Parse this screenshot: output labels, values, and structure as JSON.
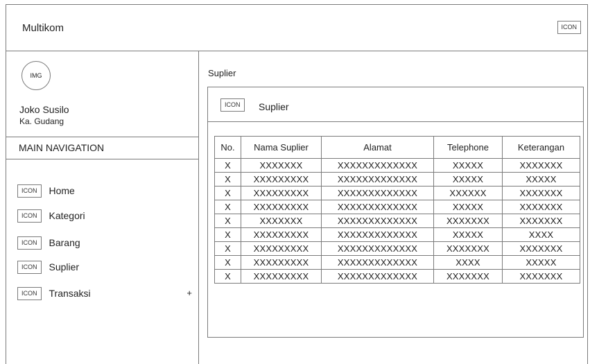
{
  "header": {
    "app_title": "Multikom",
    "icon_label": "ICON"
  },
  "sidebar": {
    "avatar_label": "IMG",
    "user_name": "Joko Susilo",
    "user_role": "Ka. Gudang",
    "nav_header": "MAIN NAVIGATION",
    "items": [
      {
        "icon": "ICON",
        "label": "Home"
      },
      {
        "icon": "ICON",
        "label": "Kategori"
      },
      {
        "icon": "ICON",
        "label": "Barang"
      },
      {
        "icon": "ICON",
        "label": "Suplier"
      },
      {
        "icon": "ICON",
        "label": "Transaksi",
        "expand": "+"
      }
    ]
  },
  "main": {
    "page_title": "Suplier",
    "panel": {
      "icon_label": "ICON",
      "title": "Suplier",
      "columns": [
        "No.",
        "Nama Suplier",
        "Alamat",
        "Telephone",
        "Keterangan"
      ],
      "rows": [
        [
          "X",
          "XXXXXXX",
          "XXXXXXXXXXXXX",
          "XXXXX",
          "XXXXXXX"
        ],
        [
          "X",
          "XXXXXXXXX",
          "XXXXXXXXXXXXX",
          "XXXXX",
          "XXXXX"
        ],
        [
          "X",
          "XXXXXXXXX",
          "XXXXXXXXXXXXX",
          "XXXXXX",
          "XXXXXXX"
        ],
        [
          "X",
          "XXXXXXXXX",
          "XXXXXXXXXXXXX",
          "XXXXX",
          "XXXXXXX"
        ],
        [
          "X",
          "XXXXXXX",
          "XXXXXXXXXXXXX",
          "XXXXXXX",
          "XXXXXXX"
        ],
        [
          "X",
          "XXXXXXXXX",
          "XXXXXXXXXXXXX",
          "XXXXX",
          "XXXX"
        ],
        [
          "X",
          "XXXXXXXXX",
          "XXXXXXXXXXXXX",
          "XXXXXXX",
          "XXXXXXX"
        ],
        [
          "X",
          "XXXXXXXXX",
          "XXXXXXXXXXXXX",
          "XXXX",
          "XXXXX"
        ],
        [
          "X",
          "XXXXXXXXX",
          "XXXXXXXXXXXXX",
          "XXXXXXX",
          "XXXXXXX"
        ]
      ]
    }
  }
}
